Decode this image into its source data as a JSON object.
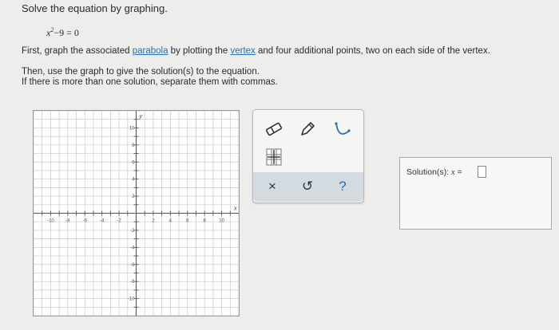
{
  "prompt": {
    "title": "Solve the equation by graphing.",
    "equation_base": "x",
    "equation_exp": "2",
    "equation_rest": "−9 = 0",
    "instr1_a": "First, graph the associated ",
    "instr1_link1": "parabola",
    "instr1_b": " by plotting the ",
    "instr1_link2": "vertex",
    "instr1_c": " and four additional points, two on each side of the vertex.",
    "instr2_line1": "Then, use the graph to give the solution(s) to the equation.",
    "instr2_line2": "If there is more than one solution, separate them with commas."
  },
  "graph": {
    "x_axis_label": "x",
    "y_axis_label": "y",
    "x_ticks": [
      "-10",
      "-8",
      "-6",
      "-4",
      "-2",
      "2",
      "4",
      "6",
      "8",
      "10"
    ],
    "y_ticks": [
      "10",
      "8",
      "6",
      "4",
      "2",
      "-2",
      "-4",
      "-6",
      "-8",
      "-10"
    ]
  },
  "tools": {
    "eraser": "eraser-icon",
    "pencil": "pencil-icon",
    "curve": "parabola-tool-icon",
    "grid": "grid-tool-icon",
    "clear_symbol": "×",
    "undo_symbol": "↺",
    "help_symbol": "?"
  },
  "answer": {
    "label": "Solution(s): ",
    "var": "x",
    "eq": " ="
  },
  "colors": {
    "link": "#2a6fb0",
    "tool_bar": "#d3dbe1",
    "grid_line": "#c8c8c8"
  }
}
